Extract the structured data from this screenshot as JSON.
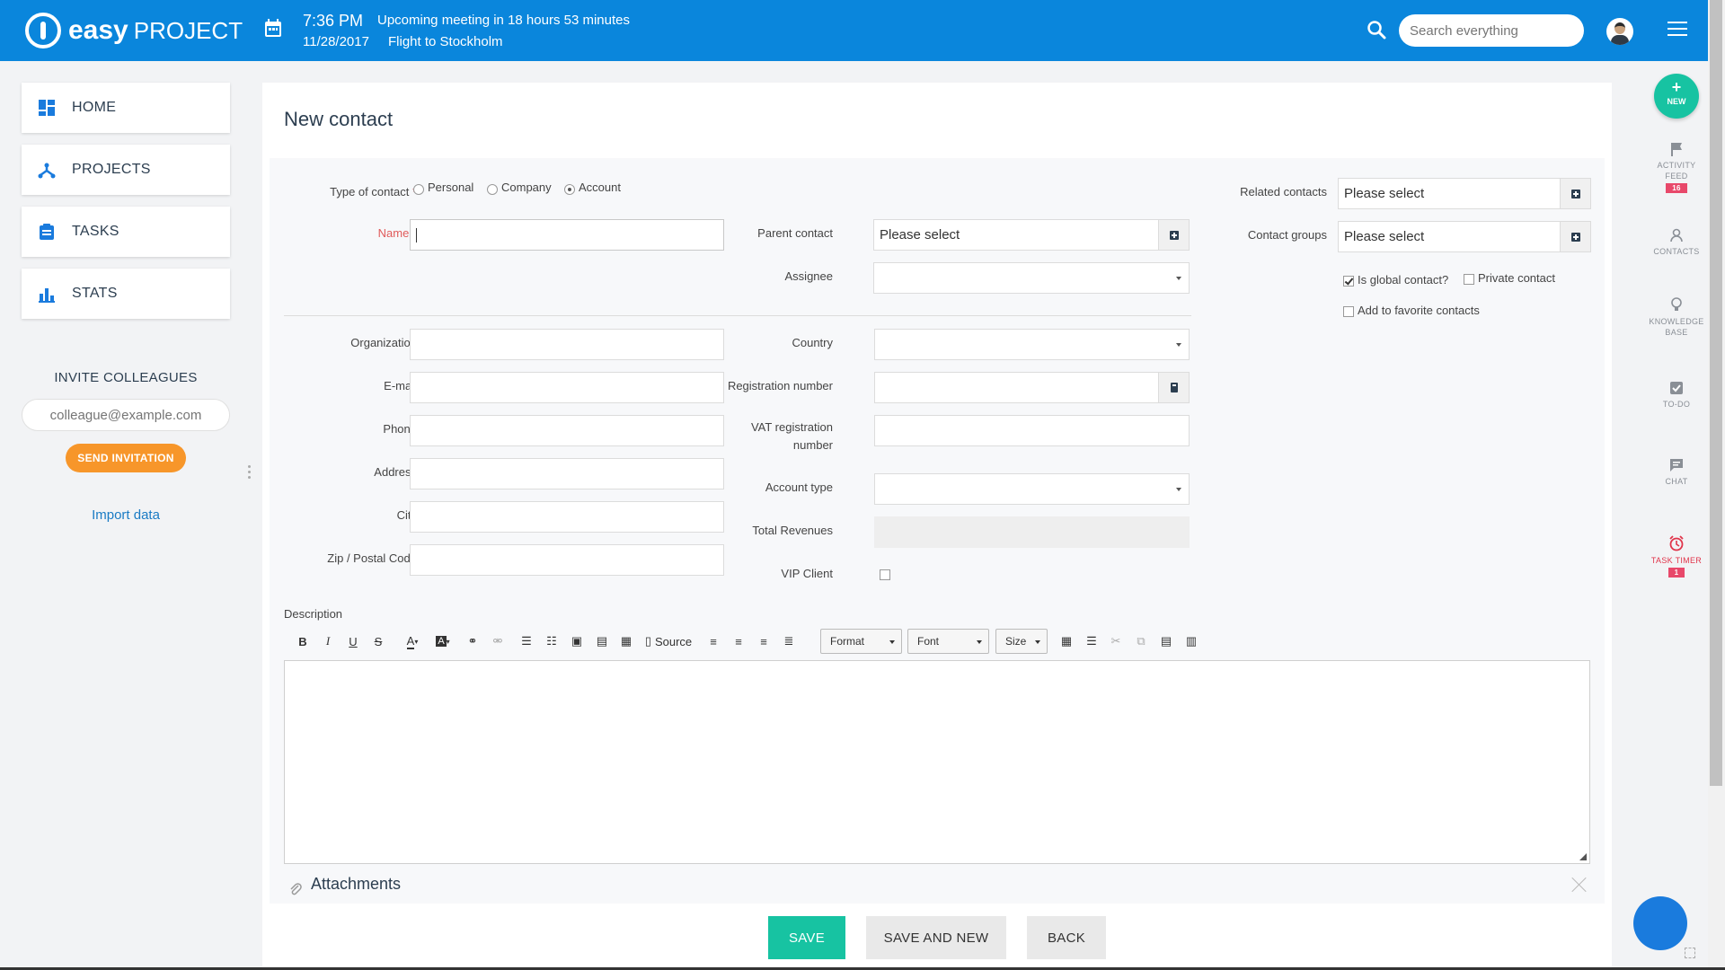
{
  "header": {
    "logo_bold": "easy",
    "logo_light": "PROJECT",
    "time": "7:36 PM",
    "date": "11/28/2017",
    "meeting": "Upcoming meeting in 18 hours 53 minutes",
    "flight": "Flight to Stockholm",
    "search_placeholder": "Search everything"
  },
  "sidebar": {
    "items": [
      {
        "label": "HOME",
        "icon": "dashboard-icon"
      },
      {
        "label": "PROJECTS",
        "icon": "projects-icon"
      },
      {
        "label": "TASKS",
        "icon": "tasks-icon"
      },
      {
        "label": "STATS",
        "icon": "stats-icon"
      }
    ],
    "invite_title": "INVITE COLLEAGUES",
    "invite_placeholder": "colleague@example.com",
    "send_invitation": "SEND INVITATION",
    "import_data": "Import data"
  },
  "form": {
    "title": "New contact",
    "type_label": "Type of contact",
    "type_options": [
      "Personal",
      "Company",
      "Account"
    ],
    "type_selected": "Account",
    "required_mark": "*",
    "name_label": "Name",
    "parent_contact_label": "Parent contact",
    "assignee_label": "Assignee",
    "please_select": "Please select",
    "related_contacts_label": "Related contacts",
    "contact_groups_label": "Contact groups",
    "is_global_label": "Is global contact?",
    "is_global_checked": true,
    "private_label": "Private contact",
    "favorite_label": "Add to favorite contacts",
    "organization_label": "Organization",
    "email_label": "E-mail",
    "phone_label": "Phone",
    "address_label": "Address",
    "city_label": "City",
    "zip_label": "Zip / Postal Code",
    "country_label": "Country",
    "registration_label": "Registration number",
    "vat_label_1": "VAT registration",
    "vat_label_2": "number",
    "account_type_label": "Account type",
    "total_revenues_label": "Total Revenues",
    "vip_label": "VIP Client",
    "description_label": "Description",
    "toolbar": {
      "source": "Source",
      "format": "Format",
      "font": "Font",
      "size": "Size"
    },
    "attachments_label": "Attachments",
    "save": "SAVE",
    "save_and_new": "SAVE AND NEW",
    "back": "BACK"
  },
  "rail": {
    "new": "NEW",
    "activity_feed_1": "ACTIVITY",
    "activity_feed_2": "FEED",
    "activity_badge": "16",
    "contacts": "CONTACTS",
    "knowledge_1": "KNOWLEDGE",
    "knowledge_2": "BASE",
    "todo": "TO-DO",
    "chat": "CHAT",
    "task_timer": "TASK TIMER",
    "task_timer_badge": "1"
  },
  "colors": {
    "header_blue": "#0a86dc",
    "save_green": "#17c3a2",
    "invite_orange": "#f7962a",
    "required_red": "#e05a5a"
  }
}
